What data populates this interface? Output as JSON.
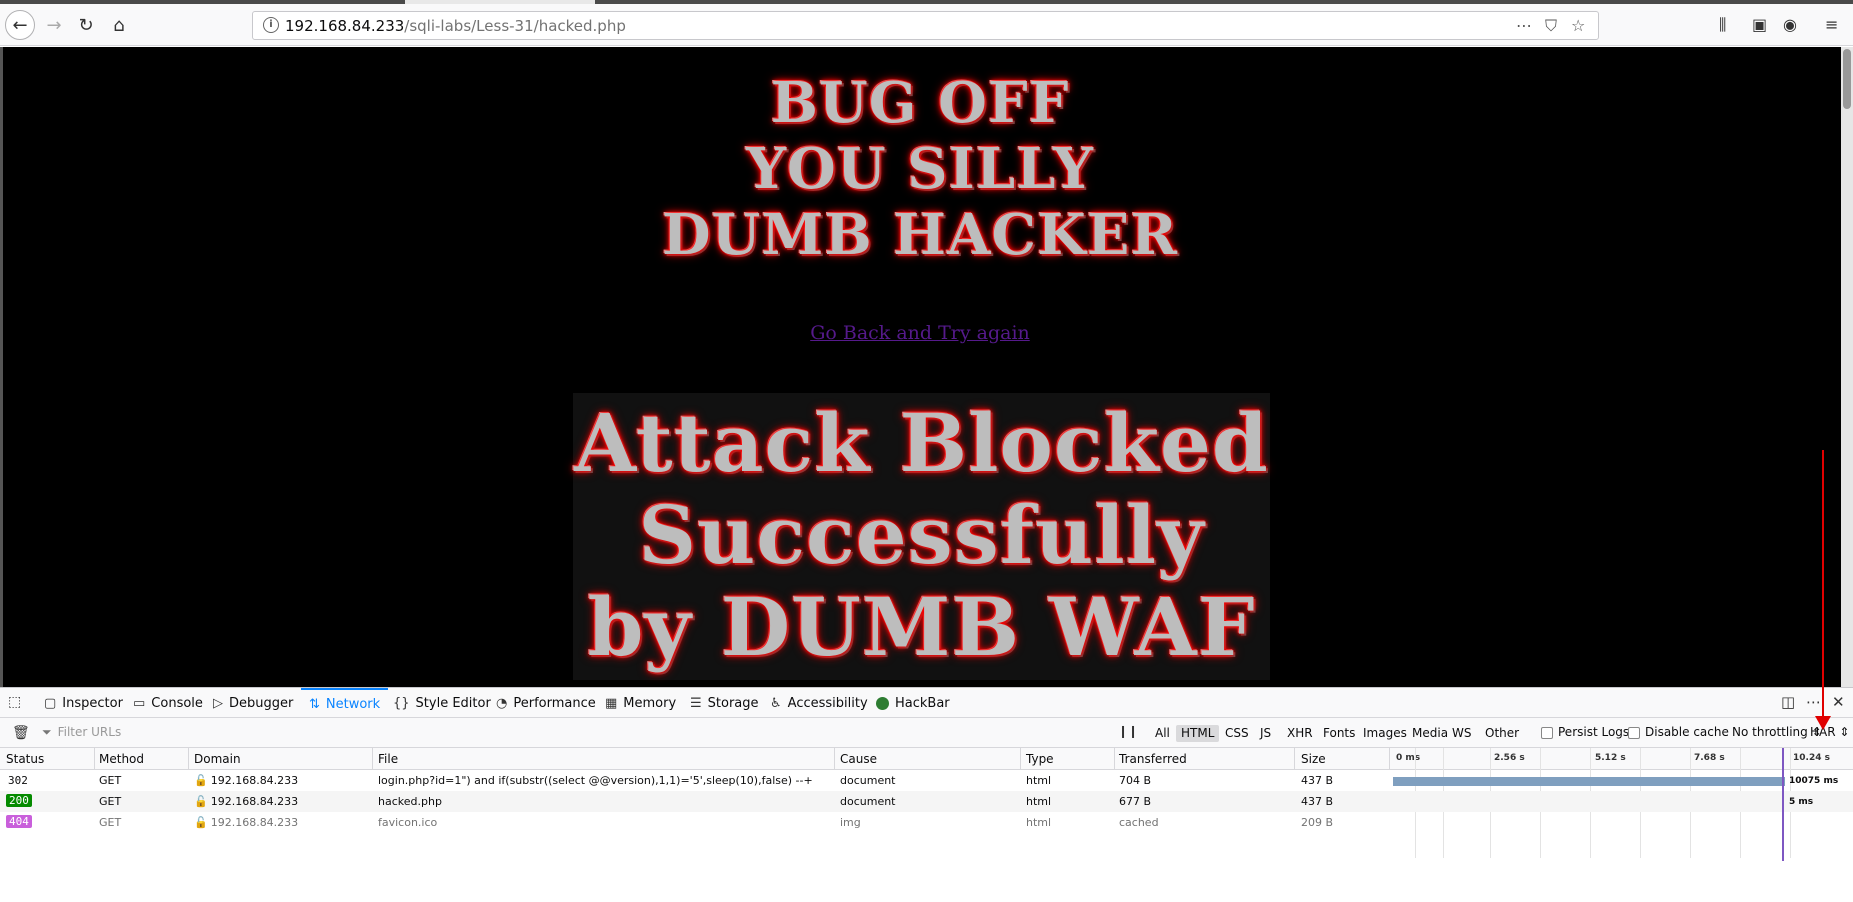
{
  "browser": {
    "url_host": "192.168.84.233",
    "url_path": "/sqli-labs/Less-31/hacked.php"
  },
  "page": {
    "bug_off_lines": [
      "BUG OFF",
      "YOU SILLY",
      "DUMB HACKER"
    ],
    "go_back_link": "Go Back and Try again",
    "attack_lines": [
      "Attack Blocked",
      "Successfully",
      "by DUMB WAF"
    ]
  },
  "devtools": {
    "tabs": [
      "Inspector",
      "Console",
      "Debugger",
      "Network",
      "Style Editor",
      "Performance",
      "Memory",
      "Storage",
      "Accessibility",
      "HackBar"
    ],
    "selected_tab": "Network",
    "filter_placeholder": "Filter URLs",
    "filter_types": [
      "All",
      "HTML",
      "CSS",
      "JS",
      "XHR",
      "Fonts",
      "Images",
      "Media",
      "WS",
      "Other"
    ],
    "selected_filter": "HTML",
    "persist_logs": "Persist Logs",
    "disable_cache": "Disable cache",
    "throttling": "No throttling",
    "har": "HAR",
    "columns": [
      "Status",
      "Method",
      "Domain",
      "File",
      "Cause",
      "Type",
      "Transferred",
      "Size"
    ],
    "timeline_ticks": [
      "0 ms",
      "2.56 s",
      "5.12 s",
      "7.68 s",
      "10.24 s"
    ],
    "requests": [
      {
        "status": "302",
        "method": "GET",
        "domain": "192.168.84.233",
        "file": "login.php?id=1\") and if(substr((select @@version),1,1)='5',sleep(10),false) --+",
        "cause": "document",
        "type": "html",
        "transferred": "704 B",
        "size": "437 B",
        "timing": "10075 ms"
      },
      {
        "status": "200",
        "method": "GET",
        "domain": "192.168.84.233",
        "file": "hacked.php",
        "cause": "document",
        "type": "html",
        "transferred": "677 B",
        "size": "437 B",
        "timing": "5 ms"
      },
      {
        "status": "404",
        "method": "GET",
        "domain": "192.168.84.233",
        "file": "favicon.ico",
        "cause": "img",
        "type": "html",
        "transferred": "cached",
        "size": "209 B",
        "timing": ""
      }
    ]
  },
  "colors": {
    "accent": "#0a84ff",
    "status_200": "#058b00",
    "status_404": "#c95fdb",
    "annotation_arrow": "#e00000"
  }
}
